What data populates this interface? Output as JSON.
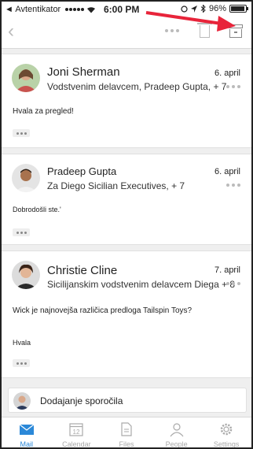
{
  "status_bar": {
    "back_app": "◄ Avtentikator",
    "time": "6:00 PM",
    "battery": "96%",
    "battery_level": 0.96
  },
  "nav": {
    "back_icon": "chevron-left-icon",
    "more_icon": "more-icon",
    "delete_icon": "trash-icon",
    "archive_icon": "archive-icon"
  },
  "messages": [
    {
      "sender": "Joni Sherman",
      "recipients": "Vodstvenim delavcem, Pradeep Gupta, + 7",
      "date": "6. april",
      "body": [
        "Hvala za pregled!"
      ]
    },
    {
      "sender": "Pradeep Gupta",
      "recipients": "Za Diego Sicilian Executives, + 7",
      "date": "6. april",
      "body": [
        "Dobrodošli ste.'"
      ]
    },
    {
      "sender": "Christie Cline",
      "recipients": "Sicilijanskim vodstvenim delavcem Diega + 8",
      "date": "7. april",
      "body": [
        "Wick je najnovejša različica predloga Tailspin Toys?",
        "Hvala"
      ]
    }
  ],
  "reply": {
    "label": "Dodajanje sporočila"
  },
  "tabs": [
    {
      "label": "Mail",
      "icon": "mail-icon",
      "active": true
    },
    {
      "label": "Calendar",
      "icon": "calendar-icon",
      "day": "12"
    },
    {
      "label": "Files",
      "icon": "file-icon"
    },
    {
      "label": "People",
      "icon": "person-icon"
    },
    {
      "label": "Settings",
      "icon": "gear-icon"
    }
  ],
  "colors": {
    "accent": "#2b88d8",
    "annotation_arrow": "#e8243a"
  }
}
